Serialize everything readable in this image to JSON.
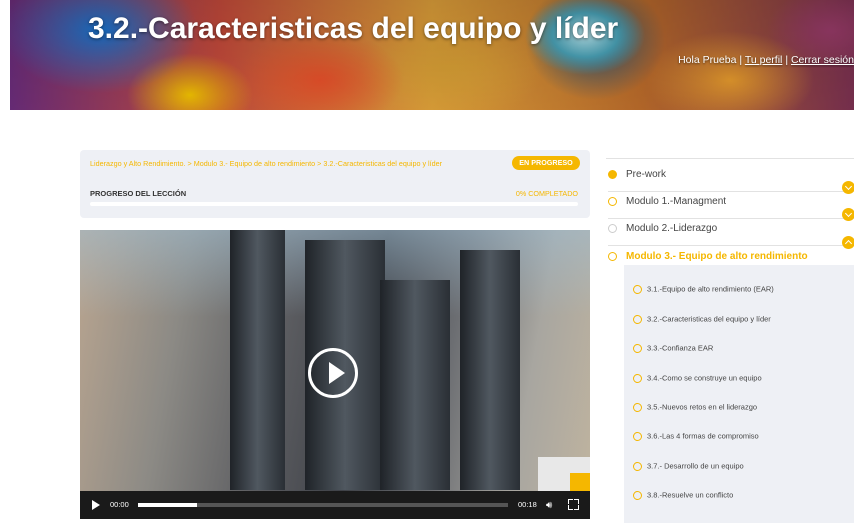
{
  "header": {
    "title": "3.2.-Caracteristicas del equipo y líder",
    "greeting": "Hola Prueba",
    "separator": "|",
    "profile_link": "Tu perfil",
    "logout_link": "Cerrar sesión"
  },
  "progress": {
    "breadcrumb": [
      "Liderazgo y Alto Rendimiento.",
      "Modulo 3.- Equipo de alto rendimiento",
      "3.2.-Caracteristicas del equipo y líder"
    ],
    "breadcrumb_sep": ">",
    "status": "EN PROGRESO",
    "label": "PROGRESO DEL LECCIÓN",
    "percent_text": "0% COMPLETADO",
    "percent": 0
  },
  "video": {
    "current_time": "00:00",
    "duration": "00:18",
    "played_fraction": 0.0,
    "buffered_fraction": 0.16
  },
  "sidebar": {
    "modules": [
      {
        "label": "Pre-work",
        "state": "completed"
      },
      {
        "label": "Modulo 1.-Managment",
        "state": "collapsed"
      },
      {
        "label": "Modulo 2.-Liderazgo",
        "state": "collapsed"
      },
      {
        "label": "Modulo 3.- Equipo de alto rendimiento",
        "state": "expanded"
      }
    ],
    "lessons": [
      "3.1.-Equipo de alto rendimiento (EAR)",
      "3.2.-Caracteristicas del equipo y líder",
      "3.3.-Confianza EAR",
      "3.4.-Como se construye un equipo",
      "3.5.-Nuevos retos en el liderazgo",
      "3.6.-Las 4 formas de compromiso",
      "3.7.- Desarrollo de un equipo",
      "3.8.-Resuelve un conflicto"
    ]
  },
  "colors": {
    "accent": "#f5b700",
    "panel": "#eef0f5",
    "text": "#444444"
  }
}
